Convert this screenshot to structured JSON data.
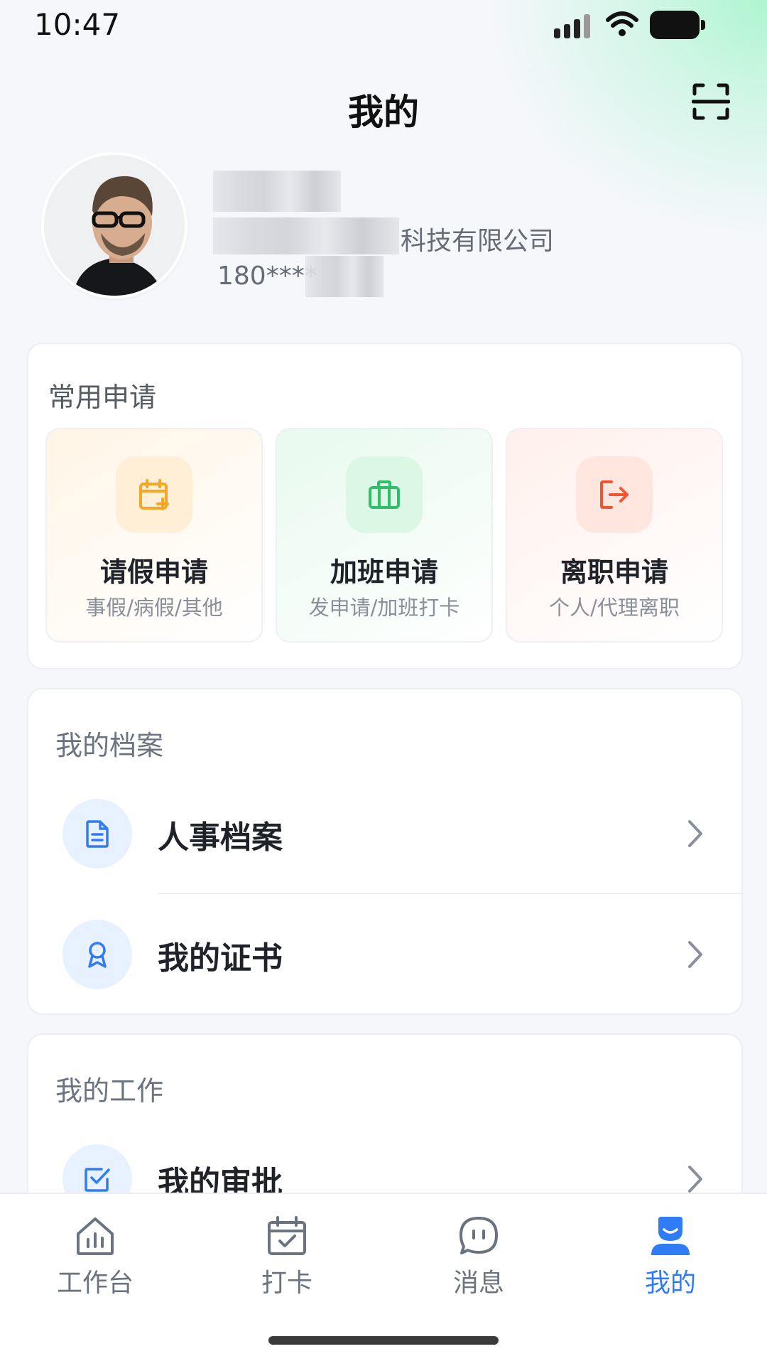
{
  "status": {
    "time": "10:47"
  },
  "header": {
    "title": "我的"
  },
  "profile": {
    "company_suffix": "科技有限公司",
    "phone_prefix": "180****"
  },
  "common_apply": {
    "title": "常用申请",
    "items": [
      {
        "label": "请假申请",
        "sub": "事假/病假/其他",
        "icon": "calendar-plus-icon",
        "color": "#f5a623"
      },
      {
        "label": "加班申请",
        "sub": "发申请/加班打卡",
        "icon": "briefcase-icon",
        "color": "#2fbf6a"
      },
      {
        "label": "离职申请",
        "sub": "个人/代理离职",
        "icon": "logout-icon",
        "color": "#f0562f"
      }
    ]
  },
  "archives": {
    "title": "我的档案",
    "items": [
      {
        "label": "人事档案",
        "icon": "document-icon"
      },
      {
        "label": "我的证书",
        "icon": "award-icon"
      }
    ]
  },
  "work": {
    "title": "我的工作",
    "items": [
      {
        "label": "我的审批",
        "icon": "checkbox-icon"
      }
    ]
  },
  "tabbar": {
    "items": [
      {
        "label": "工作台",
        "icon": "home-chart-icon",
        "active": false
      },
      {
        "label": "打卡",
        "icon": "calendar-check-icon",
        "active": false
      },
      {
        "label": "消息",
        "icon": "chat-bubble-icon",
        "active": false
      },
      {
        "label": "我的",
        "icon": "user-icon",
        "active": true
      }
    ]
  },
  "colors": {
    "accent": "#2f7cf6",
    "text": "#1f2329",
    "muted": "#6b7280"
  }
}
